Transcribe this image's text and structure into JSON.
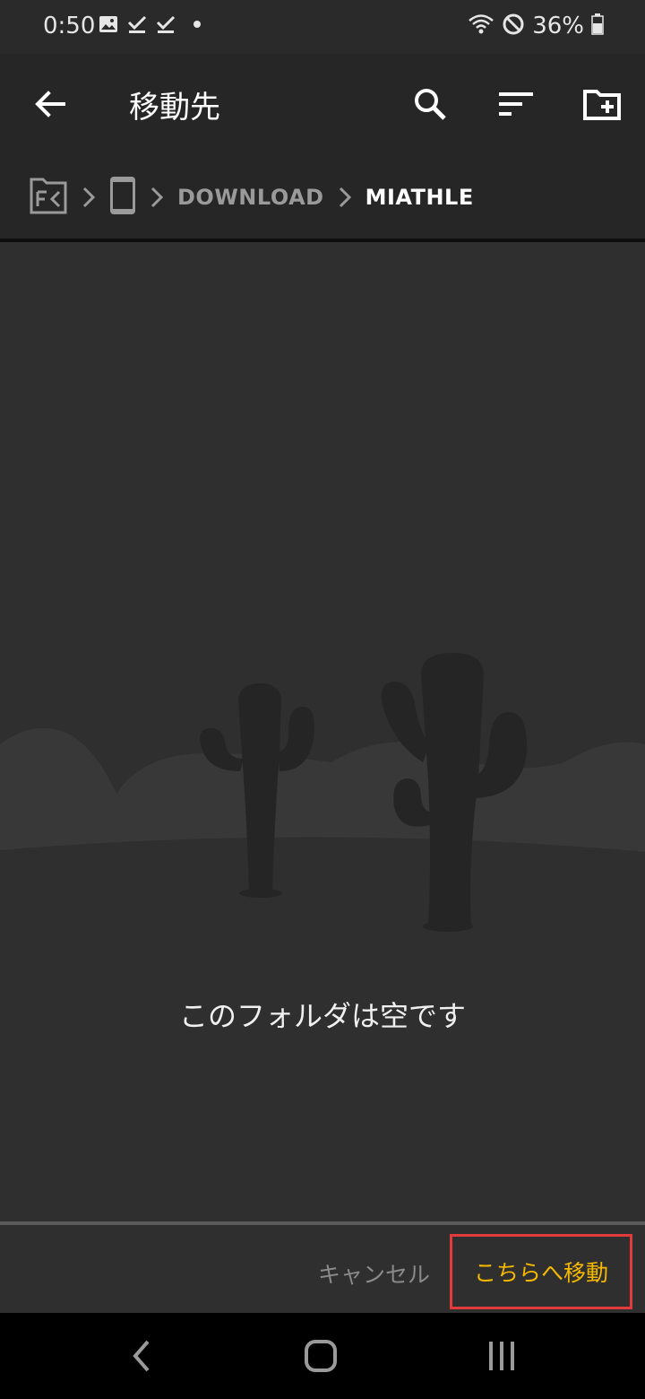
{
  "status_bar": {
    "time": "0:50",
    "battery": "36%",
    "icons": [
      "image-icon",
      "check-download-icon",
      "check-download-icon",
      "dot-icon",
      "wifi-icon",
      "dnd-icon",
      "battery-icon"
    ]
  },
  "app_bar": {
    "title": "移動先",
    "icons": [
      "back-arrow-icon",
      "search-icon",
      "sort-icon",
      "new-folder-icon"
    ]
  },
  "breadcrumb": {
    "items": [
      {
        "type": "icon",
        "icon": "fk-app-icon"
      },
      {
        "type": "icon",
        "icon": "phone-icon"
      },
      {
        "type": "text",
        "label": "DOWNLOAD",
        "active": false
      },
      {
        "type": "text",
        "label": "MIATHLE",
        "active": true
      }
    ]
  },
  "empty_state": {
    "message": "このフォルダは空です",
    "illustration": "cactus-desert-illustration"
  },
  "actions": {
    "cancel_label": "キャンセル",
    "confirm_label": "こちらへ移動",
    "confirm_color": "#f5b800",
    "highlight_color": "#e33b3b"
  },
  "nav_bar": {
    "icons": [
      "nav-back-icon",
      "nav-home-icon",
      "nav-recents-icon"
    ]
  }
}
